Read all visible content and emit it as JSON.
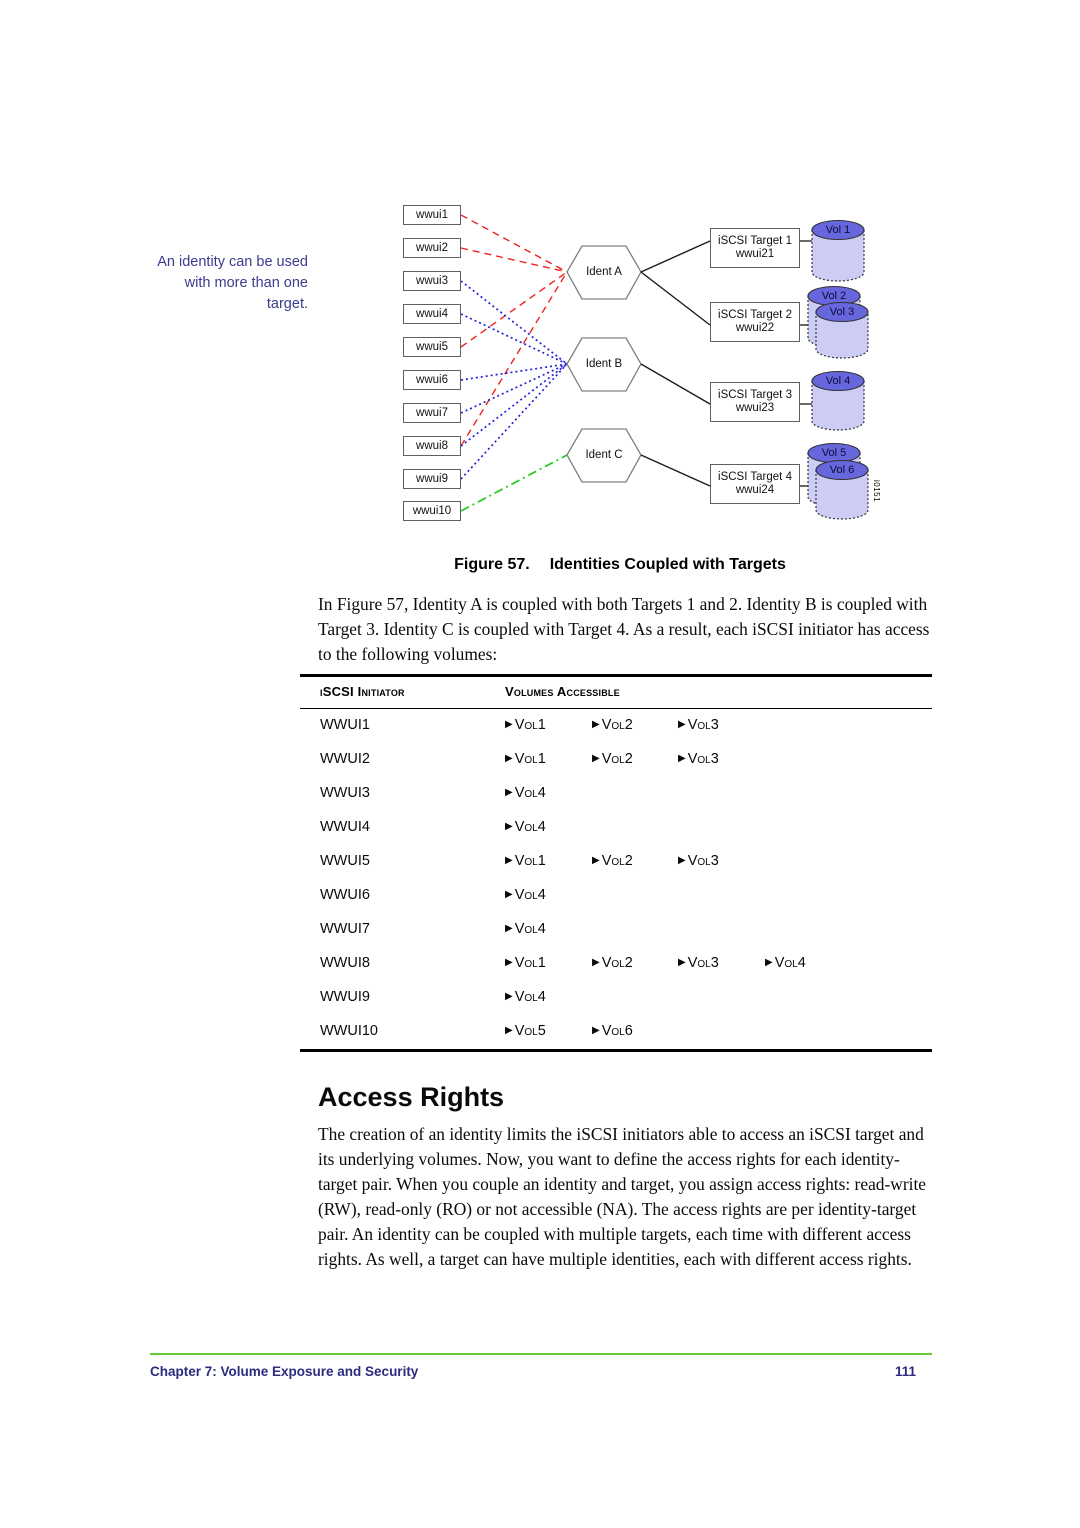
{
  "margin_note": "An identity can be used with more than one target.",
  "figure": {
    "artwork_id": "i0151",
    "initiators": [
      {
        "label": "wwui1"
      },
      {
        "label": "wwui2"
      },
      {
        "label": "wwui3"
      },
      {
        "label": "wwui4"
      },
      {
        "label": "wwui5"
      },
      {
        "label": "wwui6"
      },
      {
        "label": "wwui7"
      },
      {
        "label": "wwui8"
      },
      {
        "label": "wwui9"
      },
      {
        "label": "wwui10"
      }
    ],
    "identities": [
      {
        "label": "Ident A"
      },
      {
        "label": "Ident B"
      },
      {
        "label": "Ident C"
      }
    ],
    "targets": [
      {
        "line1": "iSCSI Target 1",
        "line2": "wwui21"
      },
      {
        "line1": "iSCSI Target 2",
        "line2": "wwui22"
      },
      {
        "line1": "iSCSI Target 3",
        "line2": "wwui23"
      },
      {
        "line1": "iSCSI Target 4",
        "line2": "wwui24"
      }
    ],
    "volumes": [
      {
        "label": "Vol 1"
      },
      {
        "label": "Vol 2"
      },
      {
        "label": "Vol 3"
      },
      {
        "label": "Vol 4"
      },
      {
        "label": "Vol 5"
      },
      {
        "label": "Vol 6"
      }
    ],
    "colors": {
      "ident_a_link": "#ee2222",
      "ident_b_link": "#2222dd",
      "ident_c_link": "#22cc22",
      "volume_top": "#6666dd",
      "volume_body": "#ccccf5",
      "box_border": "#606060"
    },
    "caption_number": "Figure 57.",
    "caption_text": "Identities Coupled with Targets"
  },
  "intro_paragraph": "In Figure 57, Identity A is coupled with both Targets 1 and 2.  Identity B is coupled with Target 3.  Identity C is coupled with Target 4.  As a result, each iSCSI initiator has access to the following volumes:",
  "table": {
    "headers": [
      "iSCSI Initiator",
      "Volumes Accessible"
    ],
    "bullet": "▶",
    "rows": [
      {
        "initiator": "WWUI1",
        "volumes": [
          "Vol1",
          "Vol2",
          "Vol3"
        ]
      },
      {
        "initiator": "WWUI2",
        "volumes": [
          "Vol1",
          "Vol2",
          "Vol3"
        ]
      },
      {
        "initiator": "WWUI3",
        "volumes": [
          "Vol4"
        ]
      },
      {
        "initiator": "WWUI4",
        "volumes": [
          "Vol4"
        ]
      },
      {
        "initiator": "WWUI5",
        "volumes": [
          "Vol1",
          "Vol2",
          "Vol3"
        ]
      },
      {
        "initiator": "WWUI6",
        "volumes": [
          "Vol4"
        ]
      },
      {
        "initiator": "WWUI7",
        "volumes": [
          "Vol4"
        ]
      },
      {
        "initiator": "WWUI8",
        "volumes": [
          "Vol1",
          "Vol2",
          "Vol3",
          "Vol4"
        ]
      },
      {
        "initiator": "WWUI9",
        "volumes": [
          "Vol4"
        ]
      },
      {
        "initiator": "WWUI10",
        "volumes": [
          "Vol5",
          "Vol6"
        ]
      }
    ]
  },
  "section": {
    "heading": "Access Rights",
    "paragraph": "The creation of an identity limits the iSCSI initiators able to access an iSCSI target and its underlying volumes.  Now, you want to define the access rights for each identity-target pair.  When you couple an identity and target, you assign access rights:  read-write (RW), read-only (RO) or not accessible (NA).  The access rights are per identity-target pair.  An identity can be coupled with multiple targets, each time with different access rights.  As well, a target can have multiple identities, each with different access rights."
  },
  "footer": {
    "chapter": "Chapter 7:  Volume Exposure and Security",
    "page_number": "111",
    "rule_color": "#66cc33",
    "text_color": "#2b2b80"
  }
}
